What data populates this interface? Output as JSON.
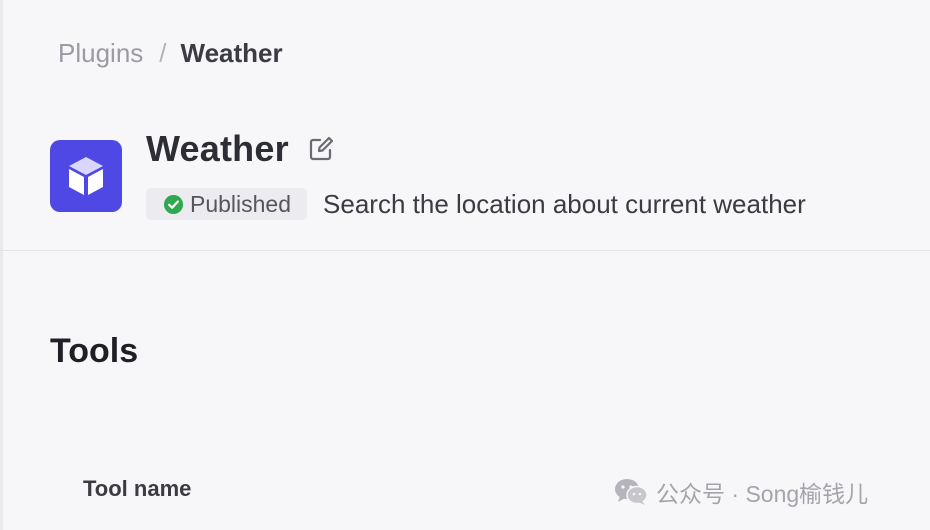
{
  "breadcrumb": {
    "root": "Plugins",
    "separator": "/",
    "current": "Weather"
  },
  "plugin": {
    "logo_icon": "cube-icon",
    "logo_color": "#5048e5",
    "name": "Weather",
    "edit_icon": "edit-icon",
    "status": {
      "label": "Published",
      "icon": "check-circle-icon",
      "color": "#2fa84f"
    },
    "description": "Search the location about current weather"
  },
  "tools_section": {
    "heading": "Tools",
    "columns": [
      "Tool name"
    ]
  },
  "watermark": {
    "icon": "wechat-icon",
    "text": "公众号 · Song榆钱儿"
  }
}
